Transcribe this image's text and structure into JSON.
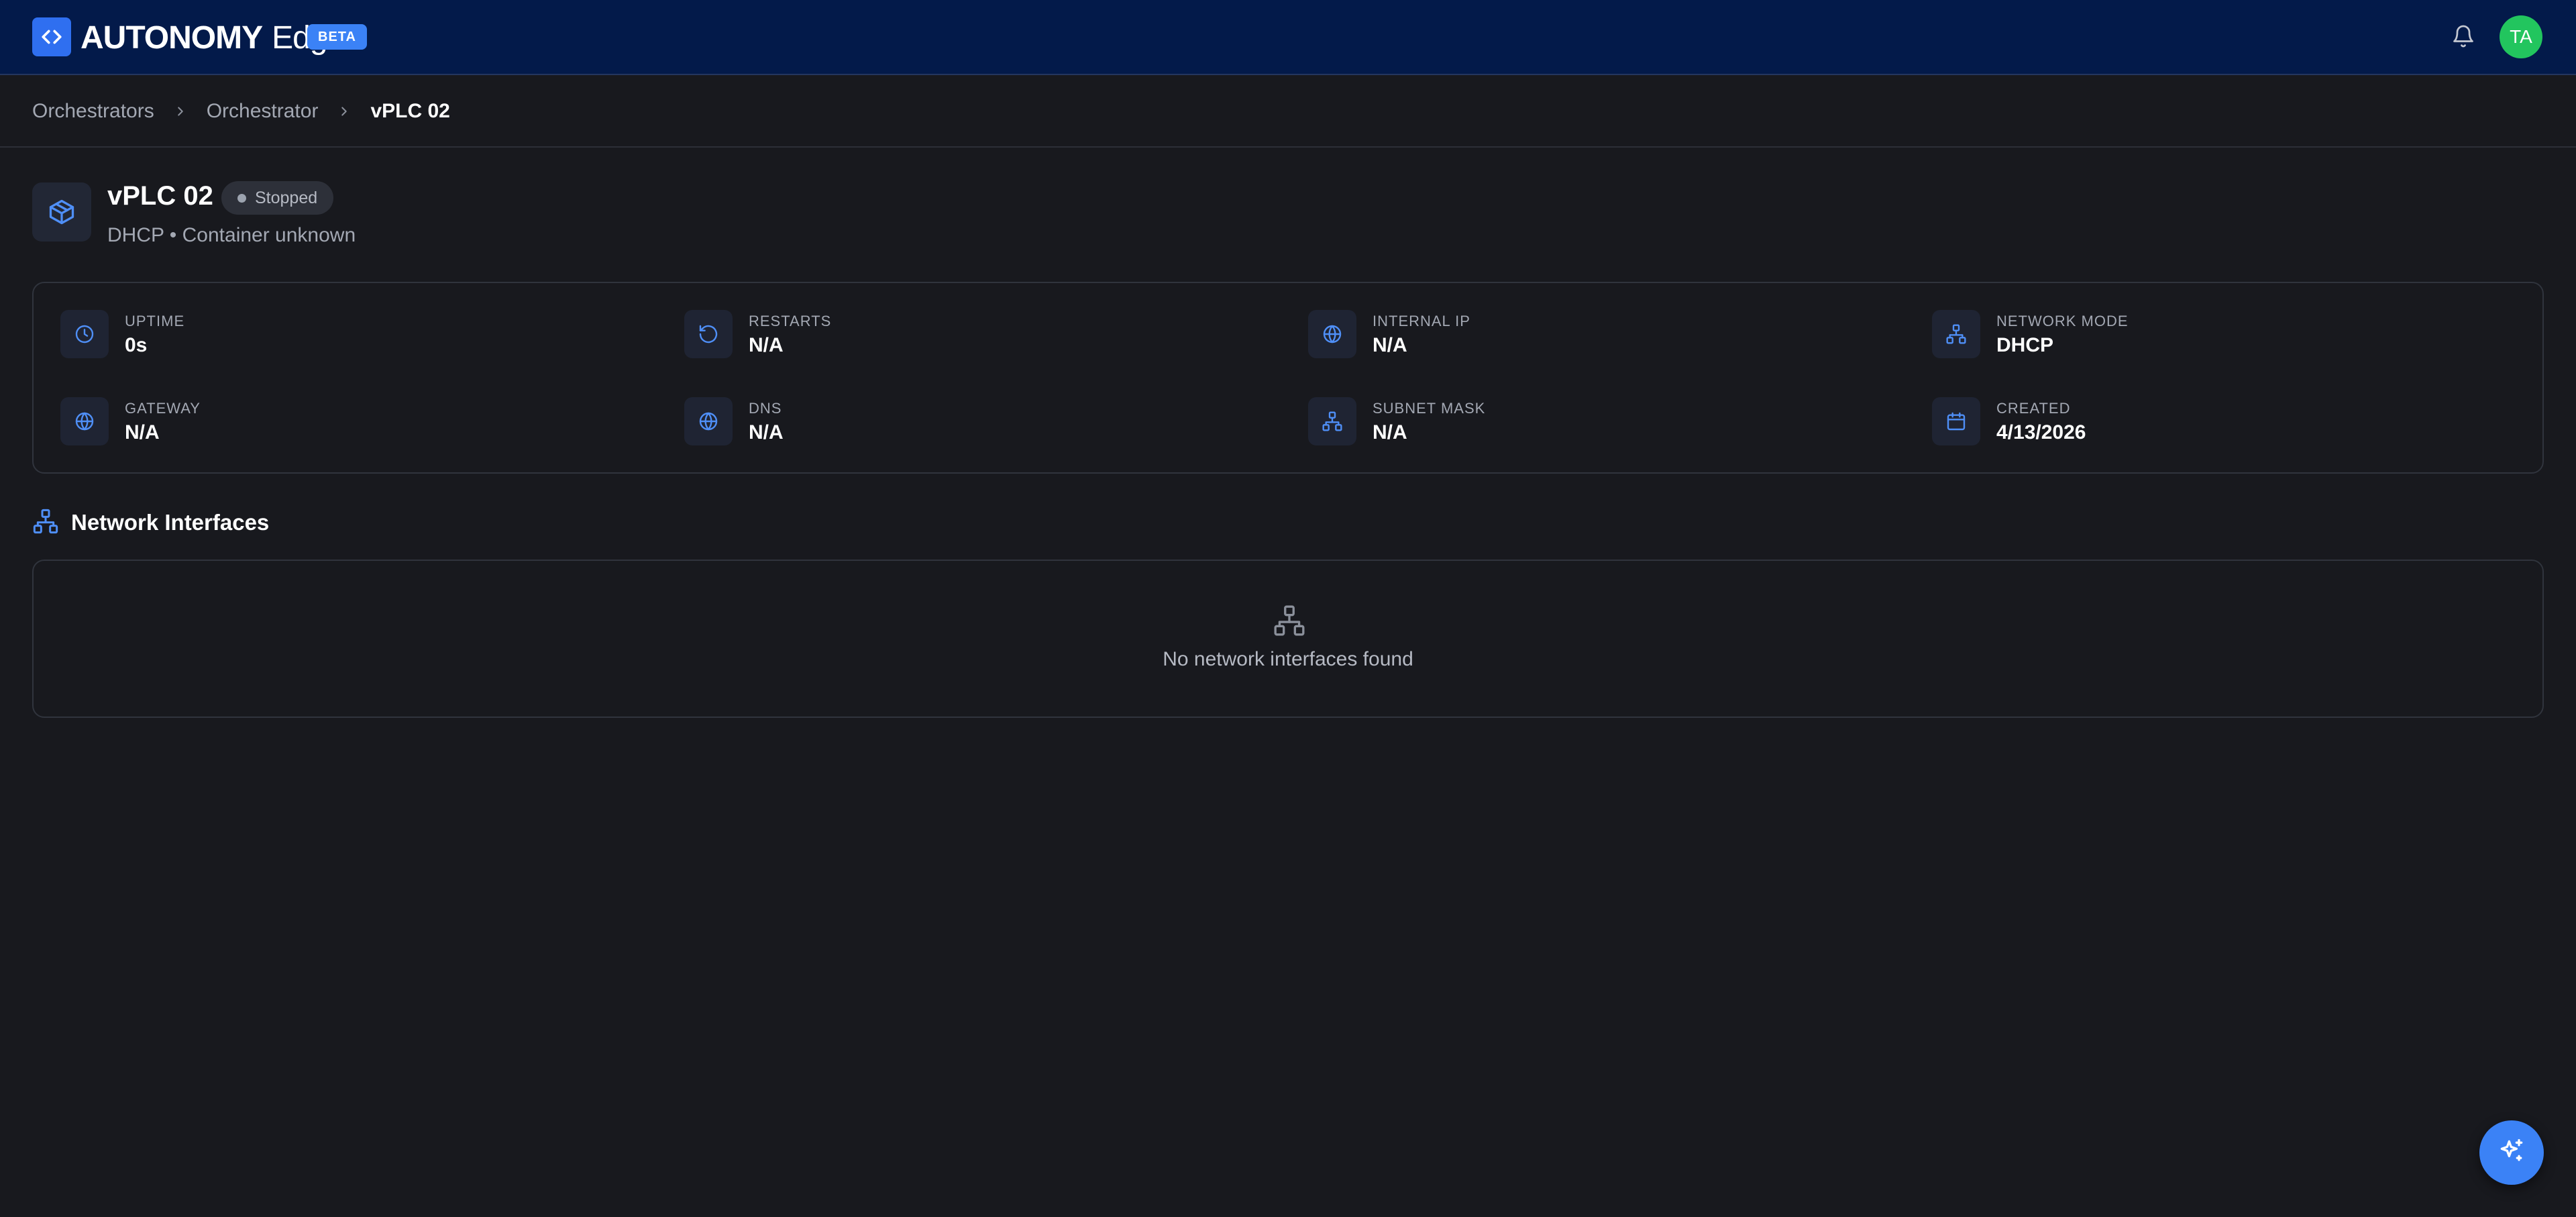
{
  "header": {
    "brand_bold": "AUTONOMY",
    "brand_light": "Edge",
    "beta_label": "BETA",
    "logo_icon": "code-brackets-icon",
    "notifications_icon": "bell-icon",
    "avatar_initials": "TA"
  },
  "breadcrumb": {
    "items": [
      {
        "label": "Orchestrators"
      },
      {
        "label": "Orchestrator"
      },
      {
        "label": "vPLC 02"
      }
    ]
  },
  "device": {
    "title": "vPLC 02",
    "status": "Stopped",
    "subtitle": "DHCP • Container unknown",
    "icon": "package-icon"
  },
  "stats": [
    {
      "label": "UPTIME",
      "value": "0s",
      "icon": "clock-icon"
    },
    {
      "label": "RESTARTS",
      "value": "N/A",
      "icon": "restart-icon"
    },
    {
      "label": "INTERNAL IP",
      "value": "N/A",
      "icon": "globe-icon"
    },
    {
      "label": "NETWORK MODE",
      "value": "DHCP",
      "icon": "network-icon"
    },
    {
      "label": "GATEWAY",
      "value": "N/A",
      "icon": "globe-icon"
    },
    {
      "label": "DNS",
      "value": "N/A",
      "icon": "globe-icon"
    },
    {
      "label": "SUBNET MASK",
      "value": "N/A",
      "icon": "network-icon"
    },
    {
      "label": "CREATED",
      "value": "4/13/2026",
      "icon": "calendar-icon"
    }
  ],
  "network_interfaces": {
    "title": "Network Interfaces",
    "empty_text": "No network interfaces found"
  },
  "colors": {
    "accent": "#3b82f6",
    "topbar": "#031a4a",
    "background": "#18191e",
    "avatar": "#22c55e"
  }
}
